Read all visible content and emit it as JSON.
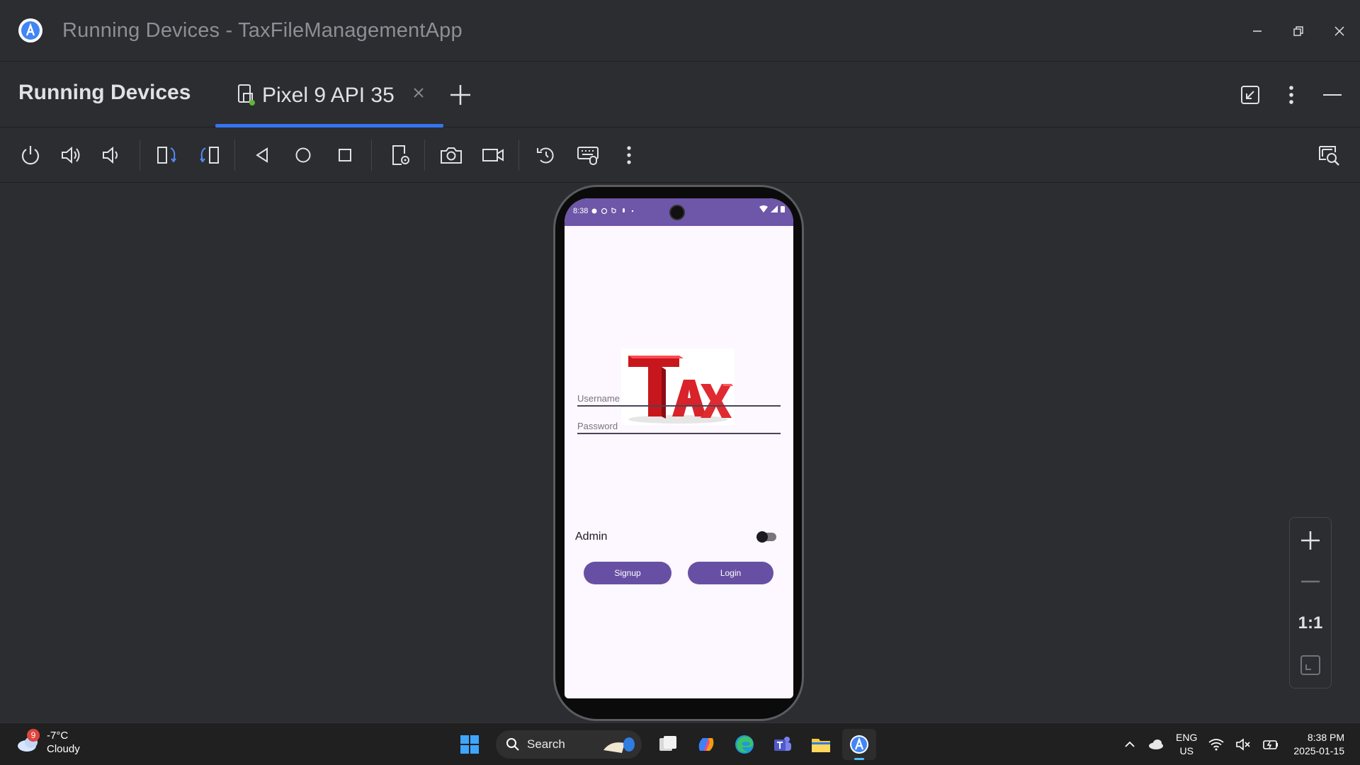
{
  "window": {
    "title": "Running Devices - TaxFileManagementApp"
  },
  "tool_window": {
    "title": "Running Devices",
    "tab_label": "Pixel 9 API 35"
  },
  "emulator": {
    "status_time": "8:38",
    "username_placeholder": "Username",
    "password_placeholder": "Password",
    "admin_label": "Admin",
    "admin_switch_on": false,
    "signup_label": "Signup",
    "login_label": "Login",
    "logo_text": "TAX"
  },
  "zoom": {
    "one_to_one_label": "1:1"
  },
  "taskbar": {
    "weather_badge": "9",
    "temperature": "-7°C",
    "condition": "Cloudy",
    "search_label": "Search",
    "lang_top": "ENG",
    "lang_bottom": "US",
    "time": "8:38 PM",
    "date": "2025-01-15"
  },
  "colors": {
    "ide_background": "#2b2d30",
    "accent_blue": "#3574f0",
    "status_bar_purple": "#6e56a8",
    "button_purple": "#6750a4",
    "app_background": "#fdf7ff",
    "logo_red": "#d8232a"
  }
}
